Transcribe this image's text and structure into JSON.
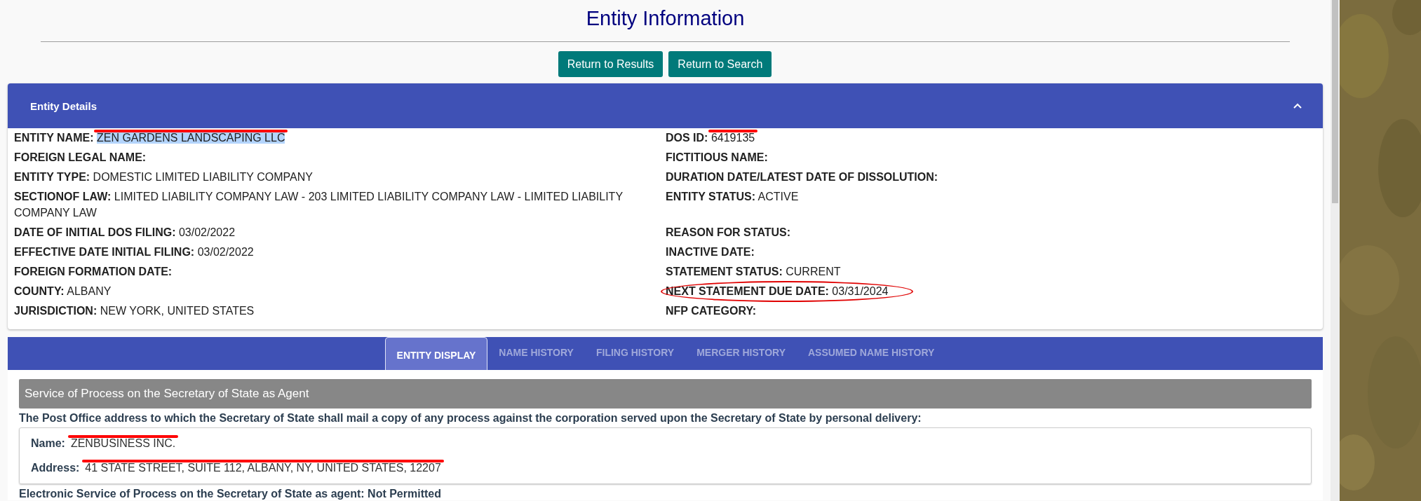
{
  "page": {
    "title": "Entity Information"
  },
  "buttons": [
    {
      "label": "Return to Results"
    },
    {
      "label": "Return to Search"
    }
  ],
  "entity_details": {
    "title": "Entity Details",
    "expanded": true,
    "rows": [
      [
        {
          "label": "ENTITY NAME:",
          "value": "ZEN GARDENS LANDSCAPING LLC",
          "redacted": true,
          "highlighted": true
        },
        {
          "label": "DOS ID:",
          "value": "6419135",
          "redacted": true
        }
      ],
      [
        {
          "label": "FOREIGN LEGAL NAME:"
        },
        {
          "label": "FICTITIOUS NAME:"
        }
      ],
      [
        {
          "label": "ENTITY TYPE:",
          "value": "DOMESTIC LIMITED LIABILITY COMPANY"
        },
        {
          "label": "DURATION DATE/LATEST DATE OF DISSOLUTION:"
        }
      ],
      [
        {
          "label": "SECTIONOF LAW:",
          "value": "LIMITED LIABILITY COMPANY LAW - 203 LIMITED LIABILITY COMPANY LAW - LIMITED LIABILITY COMPANY LAW"
        },
        {
          "label": "ENTITY STATUS:",
          "value": "ACTIVE"
        }
      ],
      [
        {
          "label": "DATE OF INITIAL DOS FILING:",
          "value": "03/02/2022"
        },
        {
          "label": "REASON FOR STATUS:"
        }
      ],
      [
        {
          "label": "EFFECTIVE DATE INITIAL FILING:",
          "value": "03/02/2022"
        },
        {
          "label": "INACTIVE DATE:"
        }
      ],
      [
        {
          "label": "FOREIGN FORMATION DATE:"
        },
        {
          "label": "STATEMENT STATUS:",
          "value": "CURRENT"
        }
      ],
      [
        {
          "label": "COUNTY:",
          "value": "ALBANY"
        },
        {
          "label": "NEXT STATEMENT DUE DATE:",
          "value": "03/31/2024",
          "circled": true
        }
      ],
      [
        {
          "label": "JURISDICTION:",
          "value": "NEW YORK, UNITED STATES"
        },
        {
          "label": "NFP CATEGORY:"
        }
      ]
    ]
  },
  "tabs": [
    {
      "label": "ENTITY DISPLAY",
      "selected": true
    },
    {
      "label": "NAME HISTORY",
      "selected": false
    },
    {
      "label": "FILING HISTORY",
      "selected": false
    },
    {
      "label": "MERGER HISTORY",
      "selected": false
    },
    {
      "label": "ASSUMED NAME HISTORY",
      "selected": false
    }
  ],
  "service_of_process": {
    "heading": "Service of Process on the Secretary of State as Agent",
    "description": "The Post Office address to which the Secretary of State shall mail a copy of any process against the corporation served upon the Secretary of State by personal delivery:",
    "fields": [
      {
        "label": "Name:",
        "value": "ZENBUSINESS INC.",
        "redacted": true
      },
      {
        "label": "Address:",
        "value": "41 STATE STREET, SUITE 112, ALBANY, NY, UNITED STATES, 12207",
        "redacted": true
      }
    ],
    "electronic_service": "Electronic Service of Process on the Secretary of State as agent: Not Permitted"
  }
}
